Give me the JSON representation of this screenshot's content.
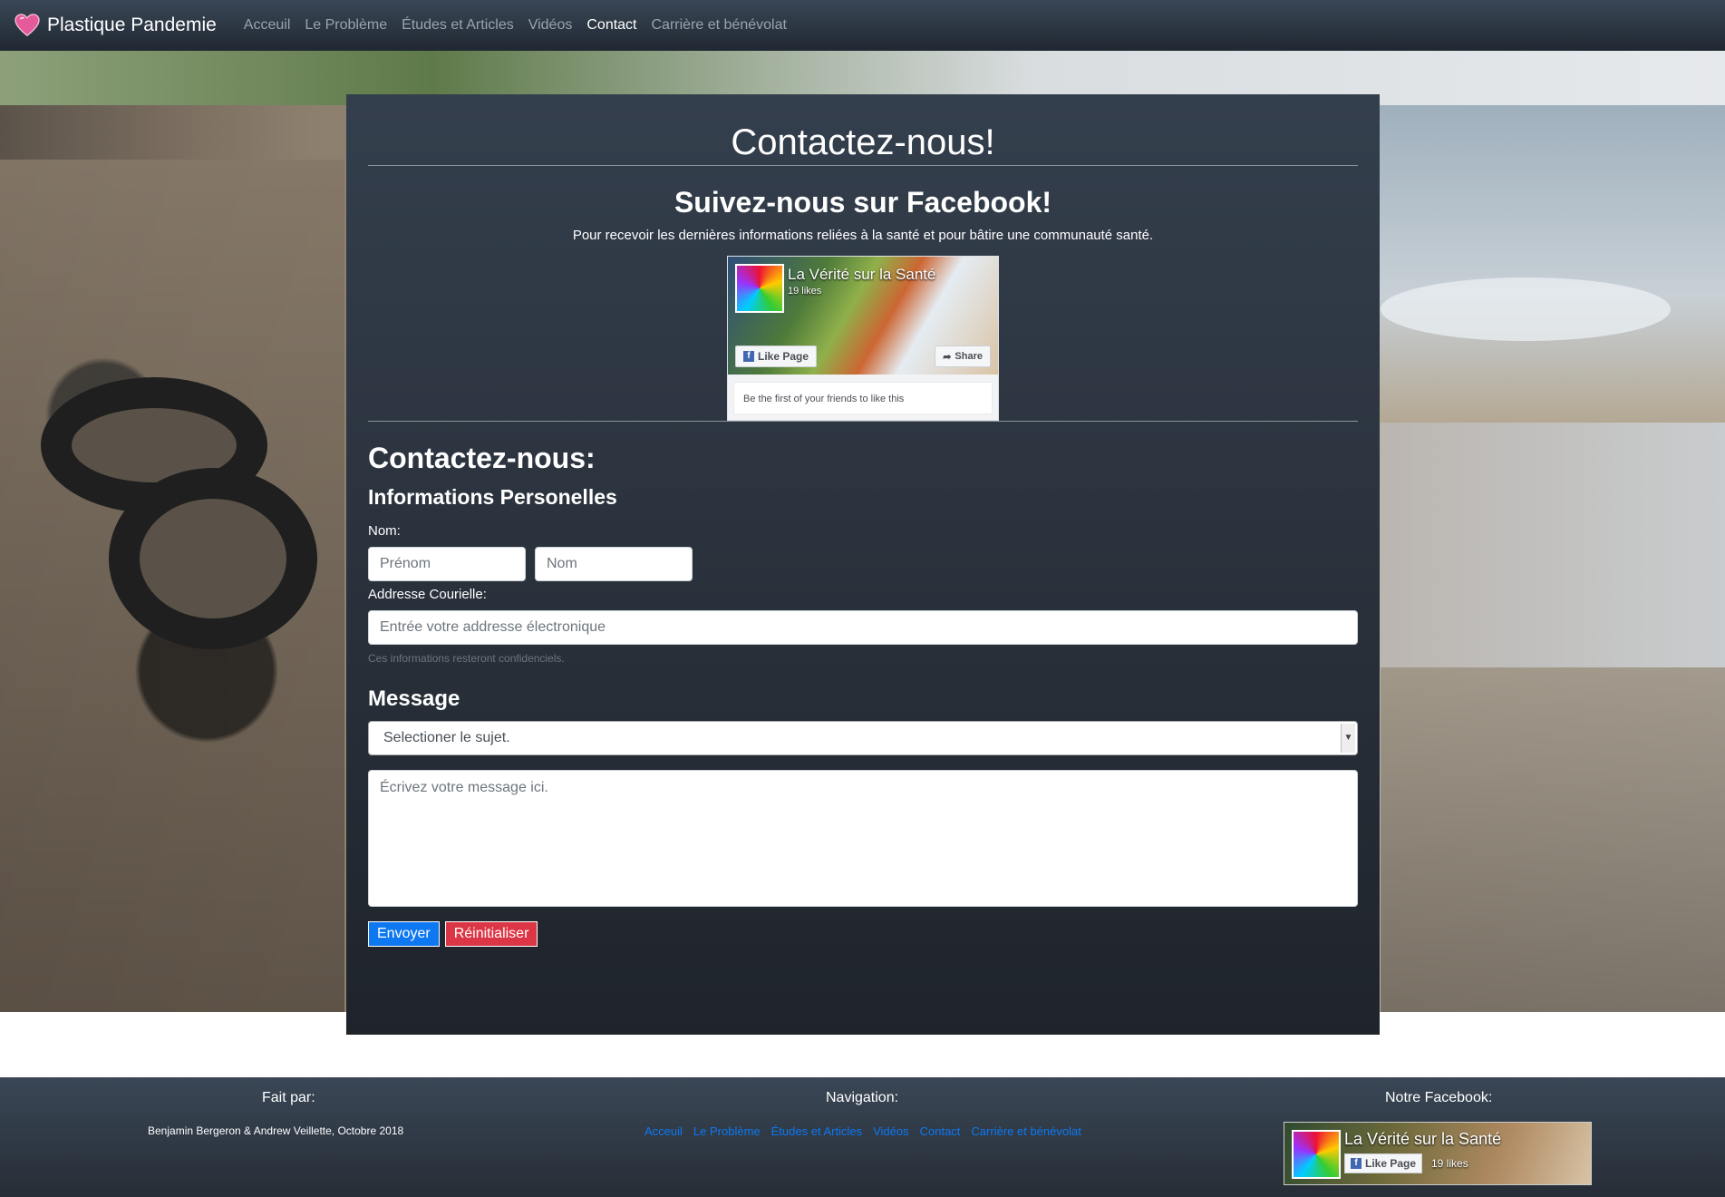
{
  "navbar": {
    "brand": "Plastique Pandemie",
    "links": [
      "Acceuil",
      "Le Problème",
      "Études et Articles",
      "Vidéos",
      "Contact",
      "Carrière et bénévolat"
    ],
    "active": "Contact"
  },
  "main": {
    "title": "Contactez-nous!",
    "facebook": {
      "heading": "Suivez-nous sur Facebook!",
      "description": "Pour recevoir les dernières informations reliées à la santé et pour bâtire une communauté santé.",
      "page_name": "La Vérité sur la Santé",
      "likes": "19 likes",
      "like_button": "Like Page",
      "share_button": "Share",
      "friends_text": "Be the first of your friends to like this"
    },
    "form": {
      "heading": "Contactez-nous:",
      "subheading": "Informations Personelles",
      "name_label": "Nom:",
      "first_name_placeholder": "Prénom",
      "last_name_placeholder": "Nom",
      "email_label": "Addresse Courielle:",
      "email_placeholder": "Entrée votre addresse électronique",
      "email_hint": "Ces informations resteront confidenciels.",
      "message_heading": "Message",
      "subject_selected": "Selectioner le sujet.",
      "message_placeholder": "Écrivez votre message ici.",
      "submit_label": "Envoyer",
      "reset_label": "Réinitialiser"
    }
  },
  "footer": {
    "made_by_title": "Fait par:",
    "credit": "Benjamin Bergeron & Andrew Veillette, Octobre 2018",
    "nav_title": "Navigation:",
    "nav_links": [
      "Acceuil",
      "Le Problème",
      "Études et Articles",
      "Vidéos",
      "Contact",
      "Carrière et bénévolat"
    ],
    "facebook_title": "Notre Facebook:",
    "fb_page_name": "La Vérité sur la Santé",
    "fb_like_button": "Like Page",
    "fb_likes": "19 likes"
  },
  "colors": {
    "link_blue": "#0d78f2",
    "danger_red": "#dc3545",
    "brand_heart": "#e45a9a"
  }
}
